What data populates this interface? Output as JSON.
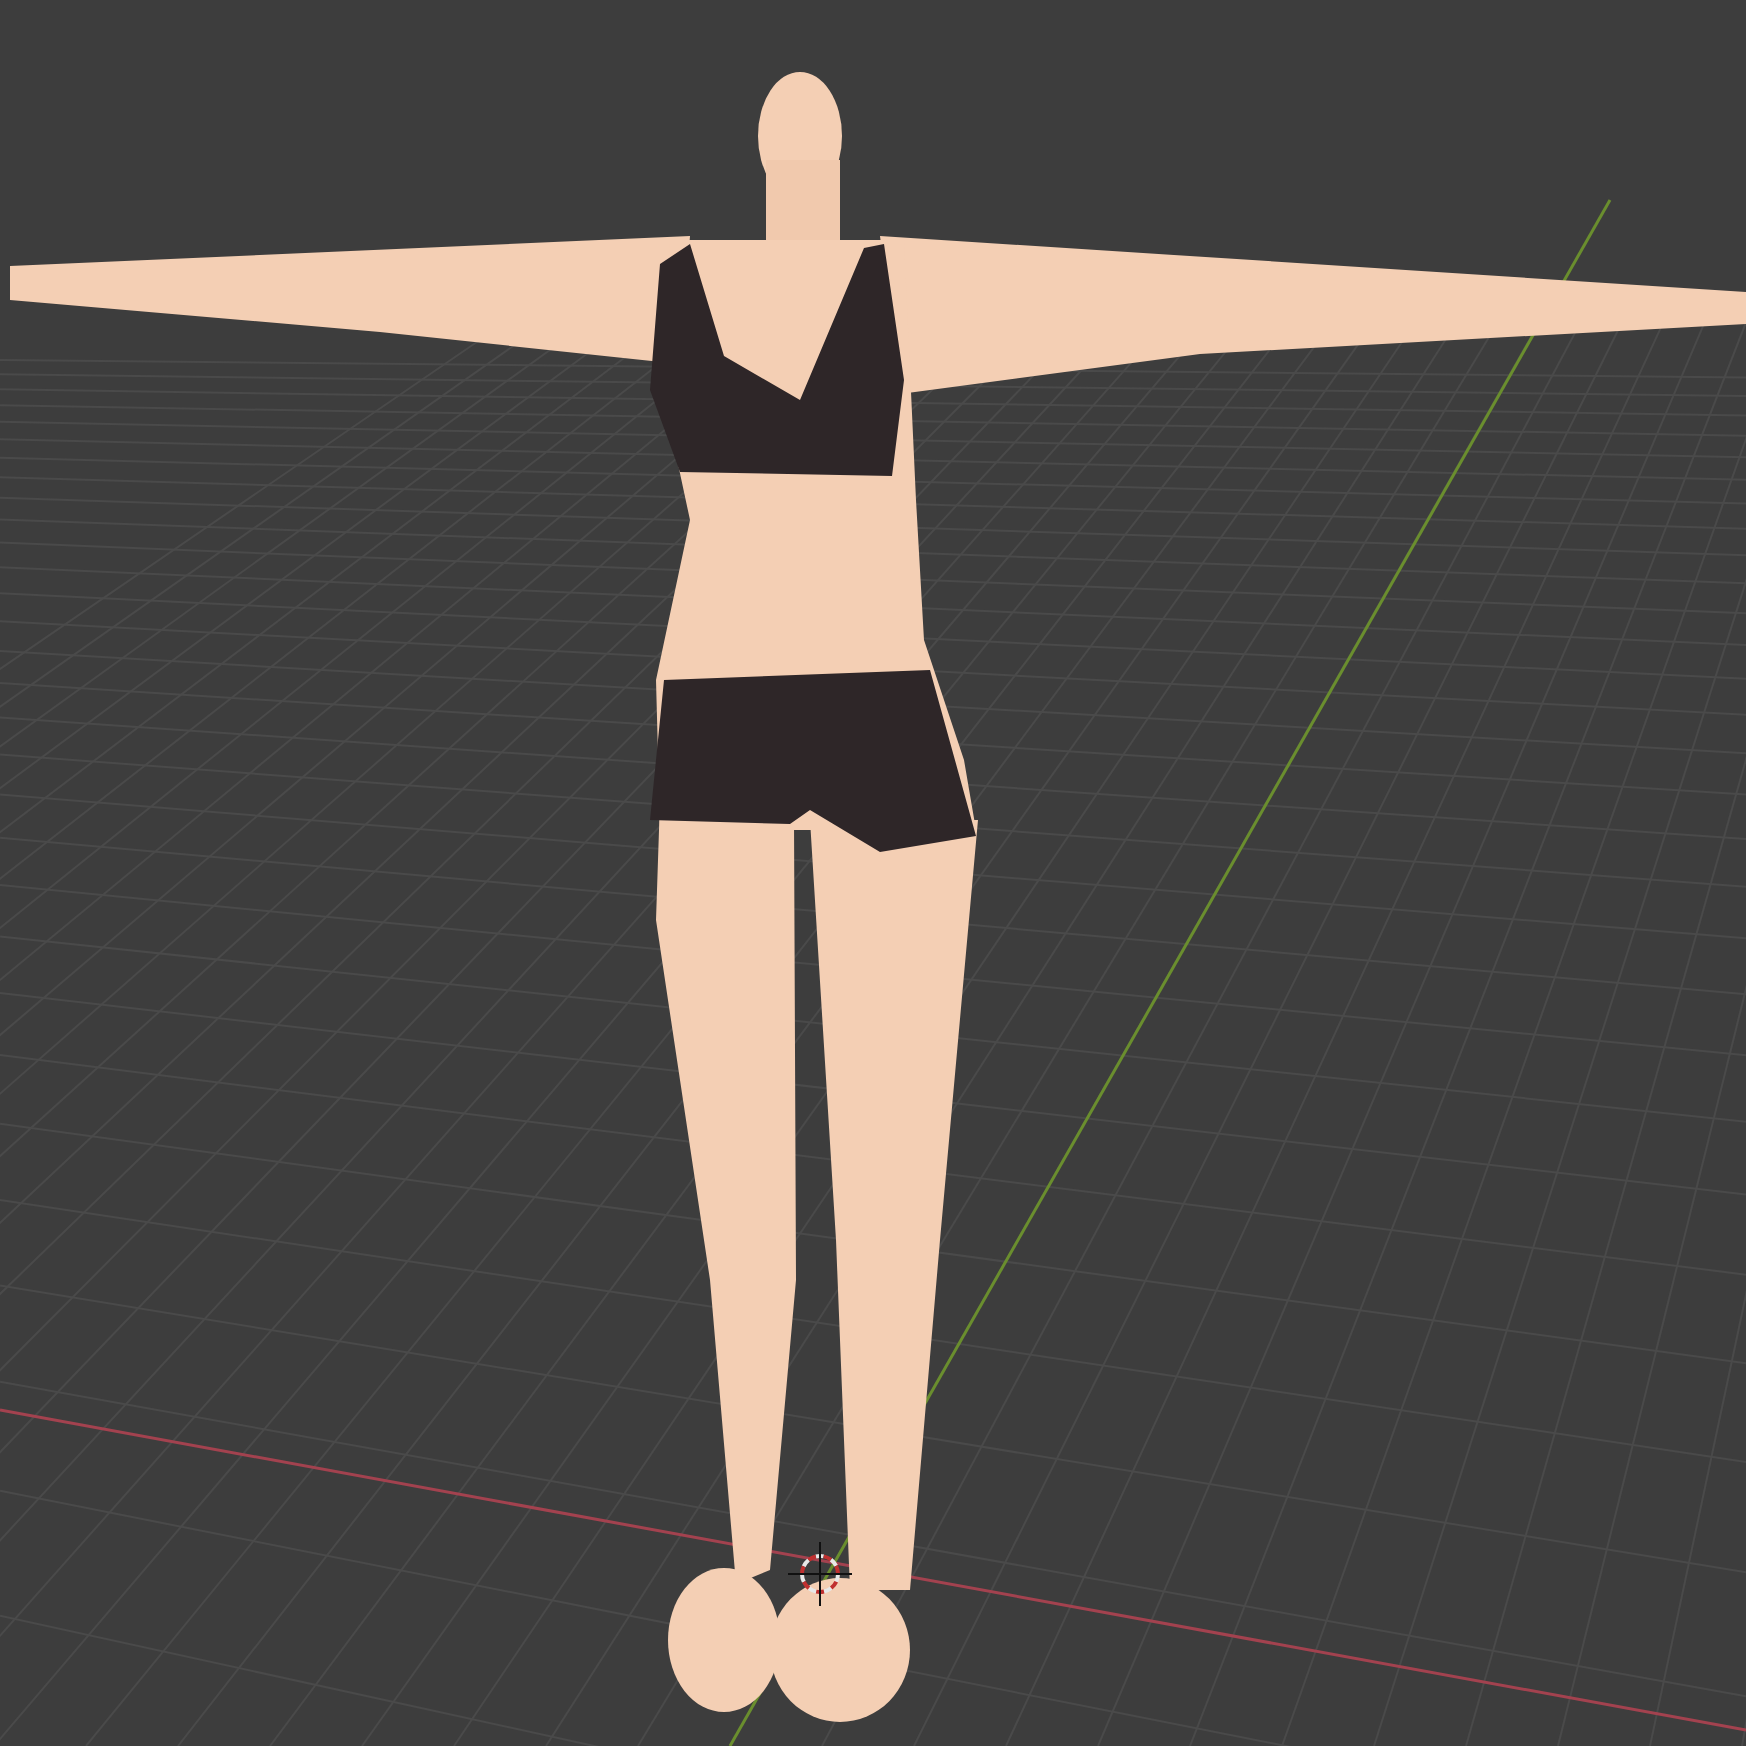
{
  "viewport": {
    "grid": true,
    "axes": true,
    "cursor_3d": true
  }
}
